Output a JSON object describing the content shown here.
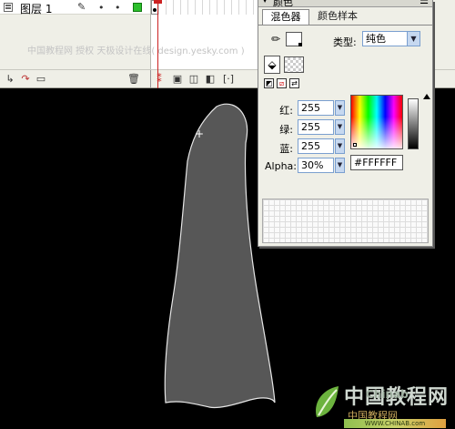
{
  "timeline": {
    "layer_name": "图层 1",
    "layer_dots": [
      "•",
      "•"
    ],
    "watermark_text": "中国教程网 授权 天极设计在线( design.yesky.com )",
    "layer_color": "#2cbf2c"
  },
  "color_panel": {
    "title": "颜色",
    "tabs": {
      "mixer": "混色器",
      "swatches": "颜色样本"
    },
    "type_label": "类型:",
    "type_value": "纯色",
    "red_label": "红:",
    "green_label": "绿:",
    "blue_label": "蓝:",
    "alpha_label": "Alpha:",
    "red_value": "255",
    "green_value": "255",
    "blue_value": "255",
    "alpha_value": "30%",
    "hex_value": "#FFFFFF"
  },
  "canvas": {
    "background": "#000000",
    "shape_fill": "#575757",
    "shape_stroke": "#e6e6e6"
  },
  "logo": {
    "main_text": "中国教程网",
    "en_text": "Chinab",
    "sub_text": "中国教程网",
    "url_text": "WWW.CHINAB.com"
  }
}
